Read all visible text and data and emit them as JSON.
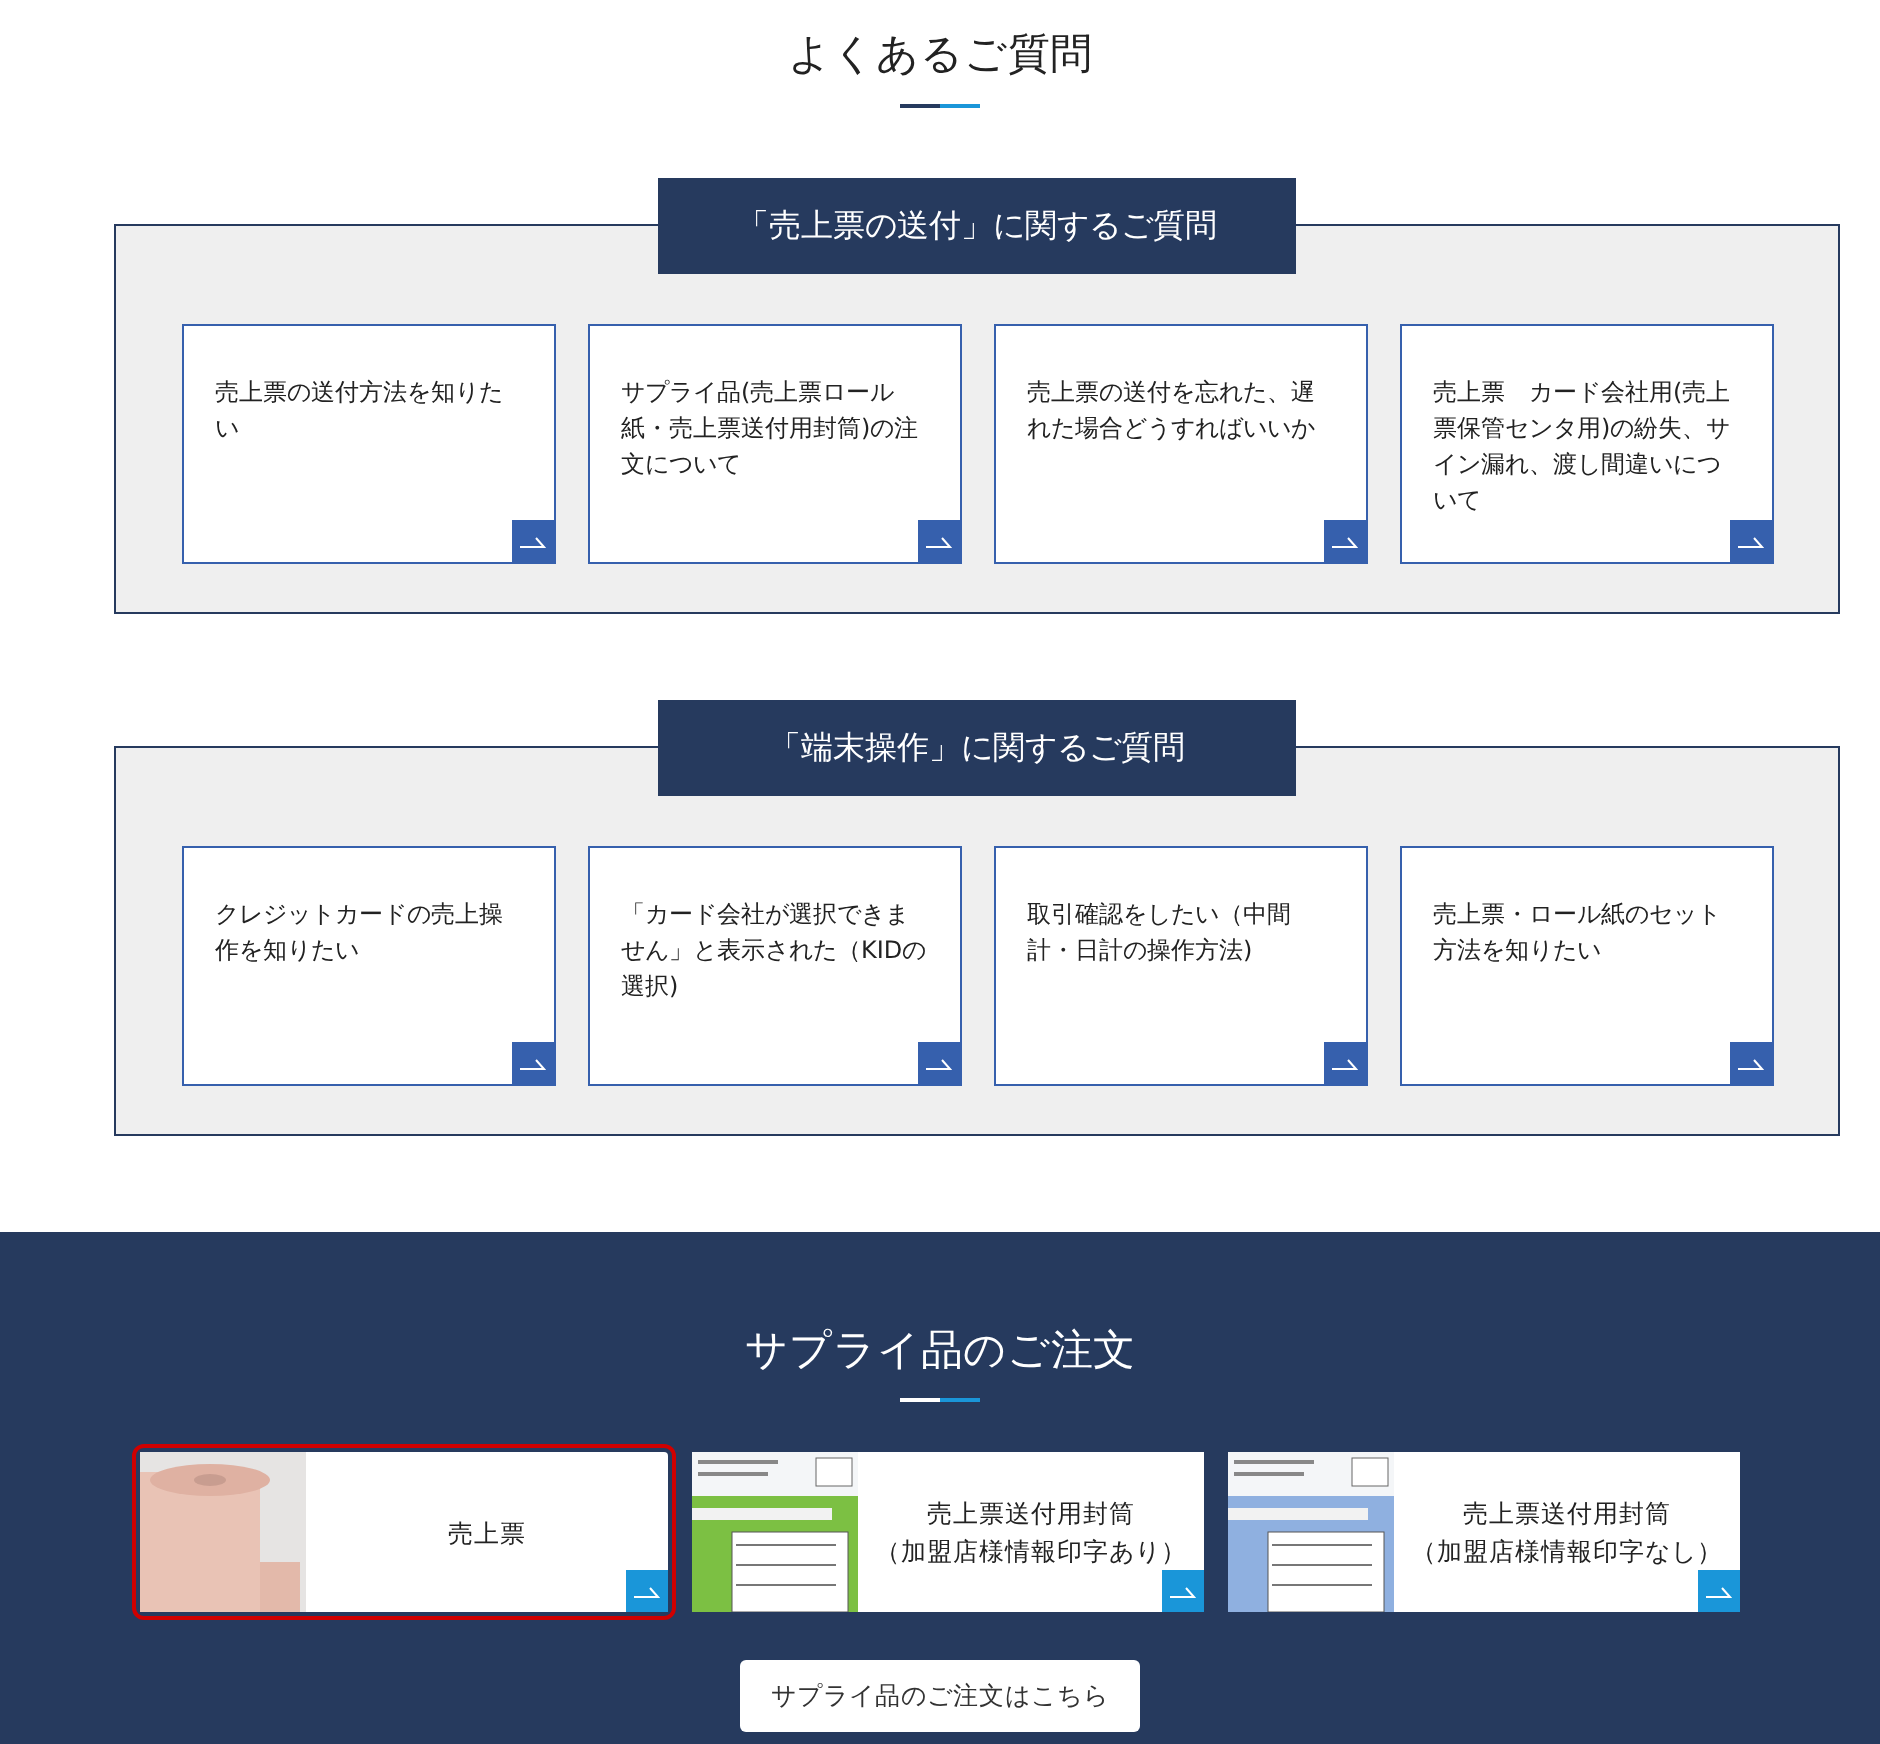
{
  "title": "よくあるご質問",
  "faq_sections": [
    {
      "heading": "「売上票の送付」に関するご質問",
      "items": [
        {
          "text": "売上票の送付方法を知りたい"
        },
        {
          "text": "サプライ品(売上票ロール紙・売上票送付用封筒)の注文について"
        },
        {
          "text": "売上票の送付を忘れた、遅れた場合どうすればいいか"
        },
        {
          "text": "売上票　カード会社用(売上票保管センタ用)の紛失、サイン漏れ、渡し間違いについて"
        }
      ]
    },
    {
      "heading": "「端末操作」に関するご質問",
      "items": [
        {
          "text": "クレジットカードの売上操作を知りたい"
        },
        {
          "text": "「カード会社が選択できません」と表示された（KIDの選択)"
        },
        {
          "text": "取引確認をしたい（中間計・日計の操作方法)"
        },
        {
          "text": "売上票・ロール紙のセット方法を知りたい"
        }
      ]
    }
  ],
  "supply": {
    "title": "サプライ品のご注文",
    "items": [
      {
        "lines": [
          "売上票"
        ],
        "selected": true
      },
      {
        "lines": [
          "売上票送付用封筒",
          "（加盟店様情報印字あり）"
        ],
        "selected": false
      },
      {
        "lines": [
          "売上票送付用封筒",
          "（加盟店様情報印字なし）"
        ],
        "selected": false
      }
    ],
    "button": "サプライ品のご注文はこちら"
  }
}
